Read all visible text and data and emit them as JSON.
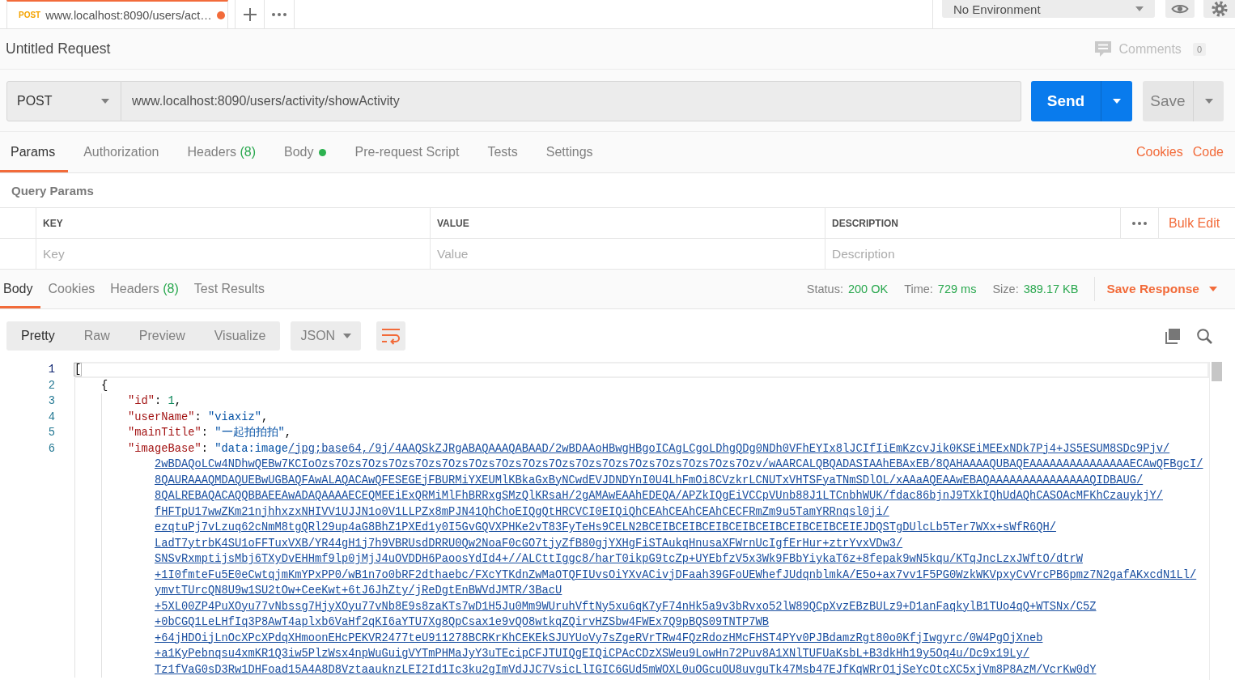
{
  "open_tabs": [
    {
      "method": "POST",
      "title": "www.localhost:8090/users/act…",
      "unsaved": true,
      "selected": true
    }
  ],
  "environment": "No Environment",
  "request": {
    "name": "Untitled Request",
    "comments": {
      "label": "Comments",
      "count": "0"
    },
    "method": "POST",
    "url": "www.localhost:8090/users/activity/showActivity",
    "send": "Send",
    "save": "Save",
    "tabs": [
      {
        "label": "Params",
        "selected": true,
        "has_content": false
      },
      {
        "label": "Authorization",
        "selected": false,
        "has_content": false
      },
      {
        "label": "Headers",
        "count": "(8)",
        "selected": false,
        "has_content": false
      },
      {
        "label": "Body",
        "selected": false,
        "has_content": true
      },
      {
        "label": "Pre-request Script",
        "selected": false,
        "has_content": false
      },
      {
        "label": "Tests",
        "selected": false,
        "has_content": false
      },
      {
        "label": "Settings",
        "selected": false,
        "has_content": false
      }
    ],
    "links": [
      "Cookies",
      "Code"
    ]
  },
  "query_params": {
    "title": "Query Params",
    "columns": [
      {
        "label": "KEY",
        "placeholder": "Key"
      },
      {
        "label": "VALUE",
        "placeholder": "Value"
      },
      {
        "label": "DESCRIPTION",
        "placeholder": "Description"
      }
    ],
    "bulk_edit": "Bulk Edit"
  },
  "response": {
    "tabs": [
      {
        "label": "Body",
        "selected": true
      },
      {
        "label": "Cookies",
        "selected": false
      },
      {
        "label": "Headers",
        "count": "(8)",
        "selected": false
      },
      {
        "label": "Test Results",
        "selected": false
      }
    ],
    "stats": [
      {
        "label": "Status:",
        "value": "200 OK"
      },
      {
        "label": "Time:",
        "value": "729 ms"
      },
      {
        "label": "Size:",
        "value": "389.17 KB"
      }
    ],
    "save_response": "Save Response",
    "view_modes": [
      {
        "label": "Pretty",
        "selected": true
      },
      {
        "label": "Raw",
        "selected": false
      },
      {
        "label": "Preview",
        "selected": false
      },
      {
        "label": "Visualize",
        "selected": false
      }
    ],
    "format": "JSON",
    "wrap_lines": true,
    "lines": [
      {
        "number": "1",
        "current": true,
        "tokens": [
          {
            "kind": "punct",
            "text": "["
          }
        ],
        "children": [
          {
            "number": "2",
            "current": false,
            "tokens": [
              {
                "kind": "punct",
                "text": "{"
              }
            ],
            "children": [
              {
                "number": "3",
                "current": false,
                "tokens": [
                  {
                    "kind": "key",
                    "text": "\"id\""
                  },
                  {
                    "kind": "punct",
                    "text": ": "
                  },
                  {
                    "kind": "number",
                    "text": "1"
                  },
                  {
                    "kind": "punct",
                    "text": ","
                  }
                ]
              },
              {
                "number": "4",
                "current": false,
                "tokens": [
                  {
                    "kind": "key",
                    "text": "\"userName\""
                  },
                  {
                    "kind": "punct",
                    "text": ": "
                  },
                  {
                    "kind": "string",
                    "text": "\"viaxiz\""
                  },
                  {
                    "kind": "punct",
                    "text": ","
                  }
                ]
              },
              {
                "number": "5",
                "current": false,
                "tokens": [
                  {
                    "kind": "key",
                    "text": "\"mainTitle\""
                  },
                  {
                    "kind": "punct",
                    "text": ": "
                  },
                  {
                    "kind": "string",
                    "text": "\"一起拍拍拍\""
                  },
                  {
                    "kind": "punct",
                    "text": ","
                  }
                ]
              },
              {
                "number": "6",
                "current": false,
                "tokens": [
                  {
                    "kind": "key",
                    "text": "\"imageBase\""
                  },
                  {
                    "kind": "punct",
                    "text": ": "
                  },
                  {
                    "kind": "string",
                    "text": "\"data:image"
                  }
                ],
                "link_rows": [
                  "/jpg;base64,/9j/4AAQSkZJRgABAQAAAQABAAD/2wBDAAoHBwgHBgoICAgLCgoLDhgQDg0NDh0VFhEYIx8lJCIfIiEmKzcvJik0KSEiMEExNDk7Pj4+JS5ESUM8SDc9Pjv/",
                  "2wBDAQoLCw4NDhwQEBw7KCIoOzs7Ozs7Ozs7Ozs7Ozs7Ozs7Ozs7Ozs7Ozs7Ozs7Ozs7Ozs7Ozs7Ozs7Ozs7Ozs7Ozv/wAARCALQBQADASIAAhEBAxEB/8QAHAAAAQUBAQEAAAAAAAAAAAAAAAECAwQFBgcI/",
                  "8QAURAAAQMDAQUEBwUGBAQFAwALAQACAwQFESEGEjFBURMiYXEUMlKBkaGxByNCwdEVJDNDYnI0U4LhFmOi8CVzkrLCNUTxVHTSFyaTNmSDlOL/xAAaAQEAAwEBAQAAAAAAAAAAAAAAAQIDBAUG/",
                  "8QALREBAQACAQQBBAEEAwADAQAAAAECEQMEEiExQRMiMlFhBRRxgSMzQlKRsaH/2gAMAwEAAhEDEQA/APZkIQgEiVCCpVUnb88J1LTCnbhWUK/fdac86bjnJ9TXkIQhUdAQhCASOAcMFKhCzauykjY/",
                  "fHFTpU17wwZKm21njhhxzxNHIVV1UJJN1o0V1LLPZx8mPJN41QhChoEIQgQtHRCVCI0EIQiQhCEAhCEAhCEAhCECFRmZm9u5TamYRRnqsl0ji/",
                  "ezqtuPj7vLzuq62cNmM8tgQRl29up4aG8BhZ1PXEd1y0I5GvGQVXPHKe2vT83FyTeHs9CELN2BCEIBCEIBCEIBCEIBCEIBCEIBCEIBCEIEJDQSTgDUlcLb5Ter7WXx+sWfR6QH/",
                  "LadT7ytrbK4SU1oFFTuxVXB/YR44gH1j7h9VBRUsdDRRU0Qw2NoaF0cGO7tjyZfB80gjYXHgFiSTAukqHnusaXFWrnUcIgfErHur+ztrYvxVDw3/",
                  "SNSvRxmptijsMbj6TXyDvEHHmf9lp0jMjJ4uOVDDH6PaoosYdId4+//ALCttIggc8/harT0ikpG9tcZp+UYEbfzV5x3Wk9FBbYiykaT6z+8fepak9wN5kqu/KTqJncLzxJWftO/dtrW",
                  "+1I0fmteFu5E0eCwtqjmKmYPxPP0/wB1n7o0bRF2dthaebc/FXcYTKdnZwMaOTQFIUvsOiYXvACivjDFaah39GFoUEWhefJUdqnblmkA/E5o+ax7vv1F5PG0WzkWKVpxyCvVrcPB6pmz7N2gafAKxcdN1Ll/",
                  "ymvtTUrcQN8U9w1SU2tOw+CeeKwt+6tJ6JhZty/jReDgtEnBWVdJMTR/3BacU",
                  "+5XL00ZP4PuXOyu77vNbssg7HjyXOyu77vNb8E9s8zaKTs7wD1H5Ju0Mm9WUruhVftNy5xu6qK7yF74nHk5a9v3bRvxo52lW89QCpXvzEBzBULz9+D1anFaqkylB1TUo4qQ+WTSNx/C5Z",
                  "+0bCGQ1LeLHfIq3P8AwT4aplxb6VaHf2qKI6aYTU7Xg8QpCsax1e9vQO8wtkqZQirvHZSbw4FWEx7Q9pBQS09TNTP7WB",
                  "+64jHDOijLnOcXPcXPdqXHmoonEHcPEKVR2477teU911278BCRKrKhCEKEkSJUYUoVy7sZgeRVrTRw4FQzRdozHMcFHST4PYv0PJBdamzRgt80o0KfjIwgyrc/0W4PgOjXneb",
                  "+a1KyPebnqsu4xmKR1Q3iw5PlzWsx4npWuGuigVYTmPHMaJyY3uTEcipCFJTUIQgEIQiCPAcCDzXSWeu9LowHn72Puv8A1XNlTUFUaKsbL+B3dkHh19y5Oq4u/Dc9x19Ly/",
                  "Tz1fVaG0sD3Rw1DHFoad15A4A8D8VztaauknzLEI2Id1Ic3ku2gImVdJJC7VsicLlIGIC6GUd5mWOXL0uOGcuOU8uvguTk47Msb47EJfKqWRrO1jSeYcOtcXC5xjVm8P8AzM/VcrKw0dY"
                ]
              }
            ]
          }
        ]
      }
    ]
  }
}
